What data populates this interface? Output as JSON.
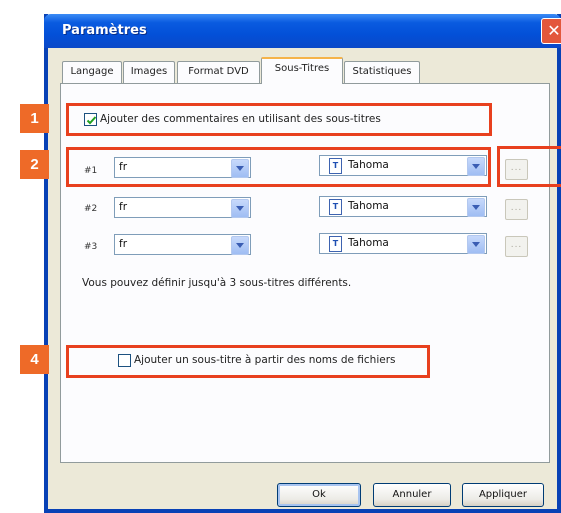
{
  "window": {
    "title": "Paramètres",
    "close_glyph": "✕"
  },
  "tabs": [
    {
      "label": "Langage"
    },
    {
      "label": "Images"
    },
    {
      "label": "Format DVD"
    },
    {
      "label": "Sous-Titres"
    },
    {
      "label": "Statistiques"
    }
  ],
  "active_tab": "Sous-Titres",
  "comments_checkbox": {
    "label": "Ajouter des commentaires en utilisant des sous-titres",
    "checked": true
  },
  "subtitle_rows": [
    {
      "number": "#1",
      "language": "fr",
      "font": "Tahoma",
      "more": "..."
    },
    {
      "number": "#2",
      "language": "fr",
      "font": "Tahoma",
      "more": "..."
    },
    {
      "number": "#3",
      "language": "fr",
      "font": "Tahoma",
      "more": "..."
    }
  ],
  "info_text": "Vous pouvez définir jusqu'à 3 sous-titres différents.",
  "filename_checkbox": {
    "label": "Ajouter un sous-titre à partir des noms de fichiers",
    "checked": false
  },
  "buttons": {
    "ok": "Ok",
    "cancel": "Annuler",
    "apply": "Appliquer"
  },
  "callouts": [
    {
      "number": "1"
    },
    {
      "number": "2"
    },
    {
      "number": "4"
    }
  ],
  "colors": {
    "callout": "#ee6a28",
    "titlebar": "#0a5be0",
    "tab_highlight": "#f5b34a"
  }
}
